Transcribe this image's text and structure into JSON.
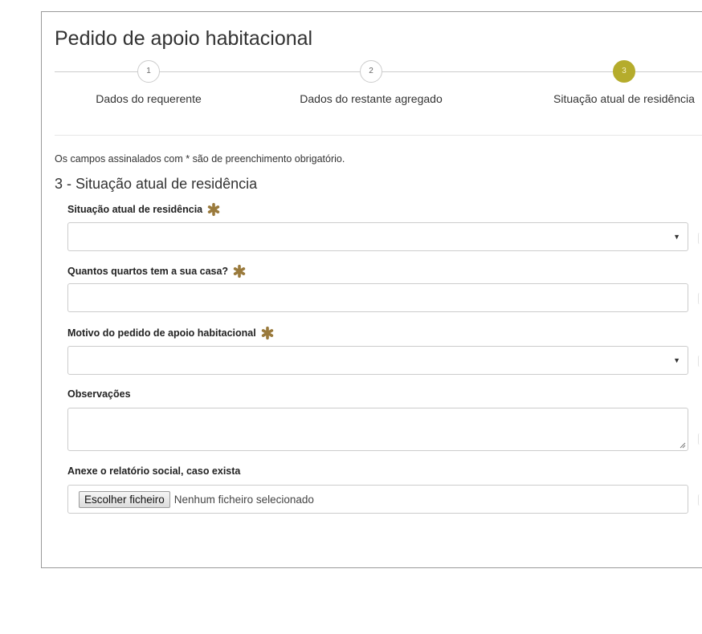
{
  "form": {
    "title": "Pedido de apoio habitacional",
    "steps": [
      {
        "number": "1",
        "label": "Dados do requerente",
        "active": false
      },
      {
        "number": "2",
        "label": "Dados do restante agregado",
        "active": false
      },
      {
        "number": "3",
        "label": "Situação atual de residência",
        "active": true
      }
    ],
    "required_note": "Os campos assinalados com * são de preenchimento obrigatório.",
    "section_title": "3 - Situação atual de residência",
    "fields": {
      "situacao": {
        "label": "Situação atual de residência",
        "value": ""
      },
      "quartos": {
        "label": "Quantos quartos tem a sua casa?",
        "value": ""
      },
      "motivo": {
        "label": "Motivo do pedido de apoio habitacional",
        "value": ""
      },
      "observacoes": {
        "label": "Observações",
        "value": ""
      },
      "anexo": {
        "label": "Anexe o relatório social, caso exista",
        "button_label": "Escolher ficheiro",
        "status": "Nenhum ficheiro selecionado"
      }
    }
  },
  "icons": {
    "required": "asterisk-icon",
    "select_caret": "caret-down-icon",
    "resize": "resize-grip-icon"
  },
  "colors": {
    "accent": "#b5ac2c",
    "required_mark": "#9a7a3c"
  }
}
